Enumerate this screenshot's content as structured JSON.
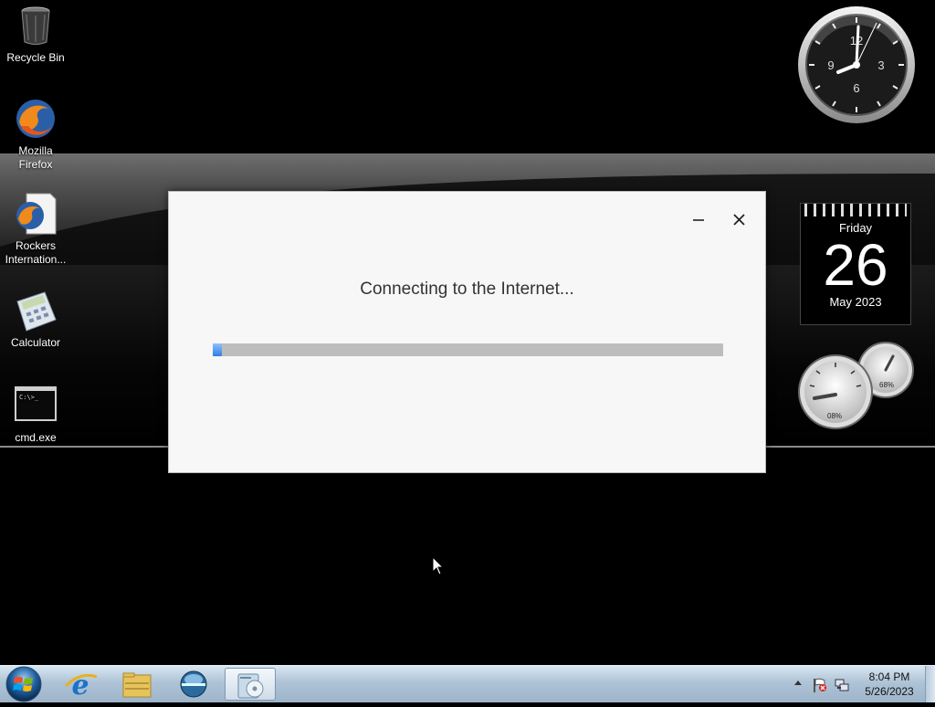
{
  "desktop": {
    "icons": [
      {
        "label": "Recycle Bin"
      },
      {
        "label": "Mozilla Firefox"
      },
      {
        "label": "Rockers Internation..."
      },
      {
        "label": "Calculator"
      },
      {
        "label": "cmd.exe"
      }
    ]
  },
  "gadgets": {
    "clock": {
      "numerals": [
        "12",
        "3",
        "6",
        "9"
      ],
      "time": "8:04"
    },
    "calendar": {
      "weekday": "Friday",
      "day": "26",
      "month_year": "May 2023"
    },
    "meters": {
      "cpu": "08%",
      "memory": "68%"
    }
  },
  "dialog": {
    "message": "Connecting to the Internet...",
    "progress_percent": 1,
    "minimize_icon": "minimize-icon",
    "close_icon": "close-icon"
  },
  "taskbar": {
    "buttons": [
      {
        "name": "internet-explorer"
      },
      {
        "name": "windows-explorer"
      },
      {
        "name": "media-center"
      },
      {
        "name": "installer",
        "active": true
      }
    ],
    "clock": {
      "time": "8:04 PM",
      "date": "5/26/2023"
    }
  },
  "colors": {
    "progress": "#2f7fe0",
    "taskbar": "#aec3d6"
  }
}
